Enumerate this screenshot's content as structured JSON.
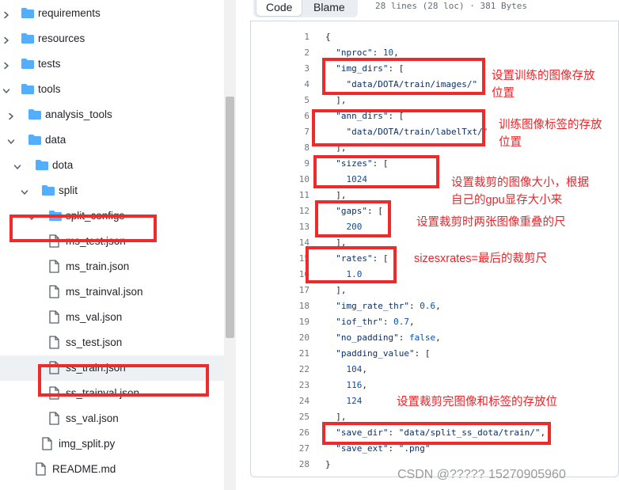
{
  "tree": {
    "rows": [
      {
        "label": "requirements",
        "type": "folder",
        "chevron": "right"
      },
      {
        "label": "resources",
        "type": "folder",
        "chevron": "right"
      },
      {
        "label": "tests",
        "type": "folder",
        "chevron": "right"
      },
      {
        "label": "tools",
        "type": "folder",
        "chevron": "down"
      },
      {
        "label": "analysis_tools",
        "type": "folder",
        "chevron": "right"
      },
      {
        "label": "data",
        "type": "folder",
        "chevron": "down"
      },
      {
        "label": "dota",
        "type": "folder",
        "chevron": "down"
      },
      {
        "label": "split",
        "type": "folder",
        "chevron": "down"
      },
      {
        "label": "split_configs",
        "type": "folder",
        "chevron": "down"
      },
      {
        "label": "ms_test.json",
        "type": "file"
      },
      {
        "label": "ms_train.json",
        "type": "file"
      },
      {
        "label": "ms_trainval.json",
        "type": "file"
      },
      {
        "label": "ms_val.json",
        "type": "file"
      },
      {
        "label": "ss_test.json",
        "type": "file"
      },
      {
        "label": "ss_train.json",
        "type": "file",
        "selected": true
      },
      {
        "label": "ss_trainval.json",
        "type": "file"
      },
      {
        "label": "ss_val.json",
        "type": "file"
      },
      {
        "label": "img_split.py",
        "type": "file"
      },
      {
        "label": "README.md",
        "type": "file"
      }
    ]
  },
  "viewer": {
    "tabs": {
      "code": "Code",
      "blame": "Blame"
    },
    "file_info": "28 lines (28 loc) · 381 Bytes",
    "lines": [
      "{",
      "  \"nproc\": 10,",
      "  \"img_dirs\": [",
      "    \"data/DOTA/train/images/\"",
      "  ],",
      "  \"ann_dirs\": [",
      "    \"data/DOTA/train/labelTxt/\"",
      "  ],",
      "  \"sizes\": [",
      "    1024",
      "  ],",
      "  \"gaps\": [",
      "    200",
      "  ],",
      "  \"rates\": [",
      "    1.0",
      "  ],",
      "  \"img_rate_thr\": 0.6,",
      "  \"iof_thr\": 0.7,",
      "  \"no_padding\": false,",
      "  \"padding_value\": [",
      "    104,",
      "    116,",
      "    124",
      "  ],",
      "  \"save_dir\": \"data/split_ss_dota/train/\",",
      "  \"save_ext\": \".png\"",
      "}"
    ]
  },
  "annotations": {
    "img_dirs_note": "设置训练的图像存放\n位置",
    "ann_dirs_note": "训练图像标签的存放\n位置",
    "sizes_note": "设置裁剪的图像大小，根据\n自己的gpu显存大小来",
    "gaps_note": "设置裁剪时两张图像重叠的尺",
    "rates_note": "sizesxrates=最后的裁剪尺",
    "save_dir_note": "设置裁剪完图像和标签的存放位"
  },
  "watermark": "CSDN @????? 15270905960",
  "colors": {
    "annotation": "#ee2a2a",
    "folder": "#54aeff",
    "selected_row": "#eef1f4"
  }
}
